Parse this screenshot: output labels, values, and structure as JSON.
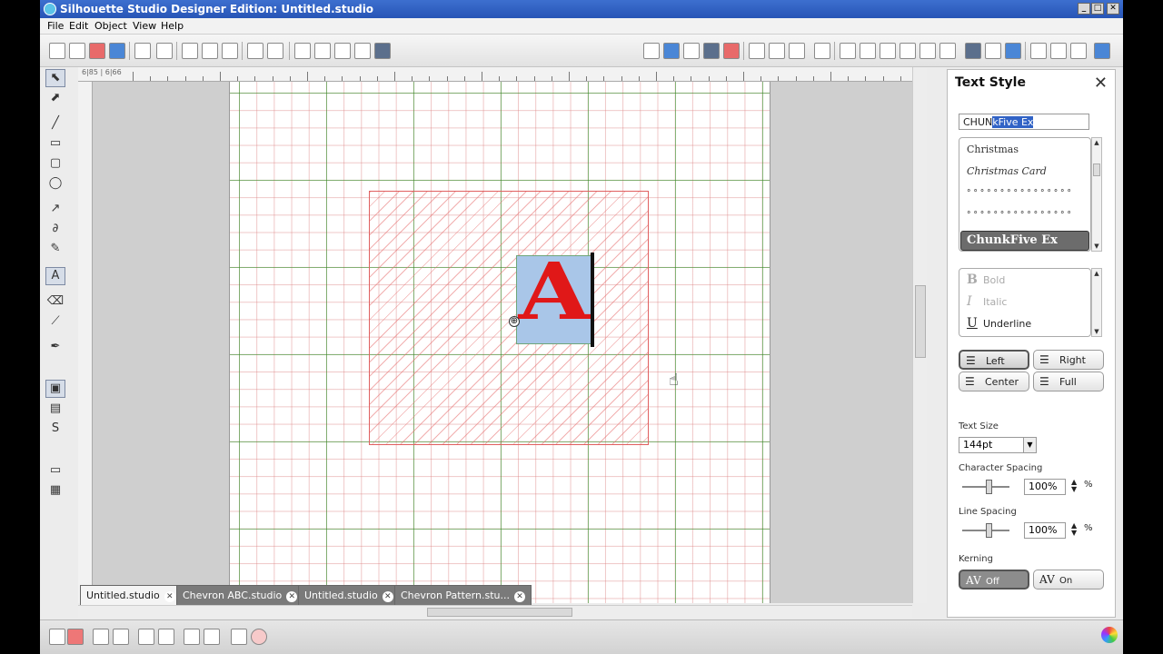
{
  "window": {
    "title": "Silhouette Studio Designer Edition: Untitled.studio",
    "controls": {
      "minimize": "_",
      "maximize": "□",
      "close": "✕"
    }
  },
  "menu": [
    "File",
    "Edit",
    "Object",
    "View",
    "Help"
  ],
  "ruler": {
    "top_label": "6|85 | 6|66"
  },
  "canvas": {
    "letter": "A",
    "rotate_handle": "⊕",
    "cursor": "☝"
  },
  "tabs": [
    {
      "label": "Untitled.studio",
      "active": true
    },
    {
      "label": "Chevron ABC.studio",
      "active": false
    },
    {
      "label": "Untitled.studio",
      "active": false
    },
    {
      "label": "Chevron Pattern.stu...",
      "active": false
    }
  ],
  "panel": {
    "title": "Text Style",
    "close": "✕",
    "font_input_typed": "CHUN",
    "font_input_selected": "kFive Ex",
    "fonts": [
      "Christmas",
      "Christmas Card",
      "° ° ° ° ° ° ° °  ° ° ° °  ° ° ° °",
      "° ° ° ° ° ° °  ° ° ° °  ° ° ° ° °"
    ],
    "selected_font": "ChunkFive Ex",
    "styles": [
      {
        "icon": "B",
        "label": "Bold",
        "enabled": false
      },
      {
        "icon": "I",
        "label": "Italic",
        "enabled": false
      },
      {
        "icon": "U",
        "label": "Underline",
        "enabled": true
      }
    ],
    "align": {
      "left": "Left",
      "right": "Right",
      "center": "Center",
      "full": "Full",
      "selected": "Left"
    },
    "text_size_label": "Text Size",
    "text_size": "144pt",
    "char_spacing_label": "Character Spacing",
    "char_spacing": "100%",
    "line_spacing_label": "Line Spacing",
    "line_spacing": "100%",
    "percent": "%",
    "kerning_label": "Kerning",
    "kerning_off": "Off",
    "kerning_on": "On",
    "kerning_icon": "AV",
    "kerning_selected": "Off"
  },
  "colors": {
    "accent": "#3163c6",
    "letter": "#e01818",
    "selection_fill": "#a9c6e8"
  }
}
